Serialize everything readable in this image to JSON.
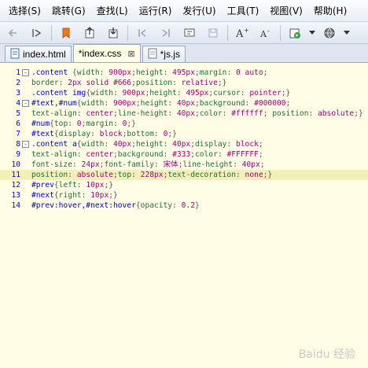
{
  "menu": [
    "选择(S)",
    "跳转(G)",
    "查找(L)",
    "运行(R)",
    "发行(U)",
    "工具(T)",
    "视图(V)",
    "帮助(H)"
  ],
  "toolbar_icons": [
    "back-icon",
    "forward-icon",
    "bookmark-icon",
    "export-icon",
    "import-icon",
    "step-back-icon",
    "step-forward-icon",
    "format-icon",
    "save-icon",
    "font-increase-icon",
    "font-decrease-icon",
    "run-icon",
    "dropdown-icon",
    "globe-icon",
    "dropdown-icon-2"
  ],
  "tabs": [
    {
      "label": "index.html",
      "icon": "html-file-icon",
      "active": false
    },
    {
      "label": "*index.css",
      "icon": "css-file-icon",
      "active": true
    },
    {
      "label": "*js.js",
      "icon": "js-file-icon",
      "active": false
    }
  ],
  "lines": [
    {
      "n": "1",
      "fold": "-",
      "segs": [
        [
          ".content ",
          "sel"
        ],
        [
          "{",
          "pun"
        ],
        [
          "width",
          "prop"
        ],
        [
          ": ",
          "pun"
        ],
        [
          "900px",
          "val"
        ],
        [
          ";",
          "pun"
        ],
        [
          "height",
          "prop"
        ],
        [
          ": ",
          "pun"
        ],
        [
          "495px",
          "val"
        ],
        [
          ";",
          "pun"
        ],
        [
          "margin",
          "prop"
        ],
        [
          ": ",
          "pun"
        ],
        [
          "0 auto",
          "val"
        ],
        [
          ";",
          "pun"
        ]
      ]
    },
    {
      "n": "2",
      "fold": "",
      "segs": [
        [
          "border",
          "prop"
        ],
        [
          ": ",
          "pun"
        ],
        [
          "2px solid #666",
          "val"
        ],
        [
          ";",
          "pun"
        ],
        [
          "position",
          "prop"
        ],
        [
          ": ",
          "pun"
        ],
        [
          "relative",
          "val"
        ],
        [
          ";}",
          "pun"
        ]
      ]
    },
    {
      "n": "3",
      "fold": "",
      "segs": [
        [
          ".content img",
          "sel"
        ],
        [
          "{",
          "pun"
        ],
        [
          "width",
          "prop"
        ],
        [
          ": ",
          "pun"
        ],
        [
          "900px",
          "val"
        ],
        [
          ";",
          "pun"
        ],
        [
          "height",
          "prop"
        ],
        [
          ": ",
          "pun"
        ],
        [
          "495px",
          "val"
        ],
        [
          ";",
          "pun"
        ],
        [
          "cursor",
          "prop"
        ],
        [
          ": ",
          "pun"
        ],
        [
          "pointer",
          "val"
        ],
        [
          ";}",
          "pun"
        ]
      ]
    },
    {
      "n": "4",
      "fold": "-",
      "segs": [
        [
          "#text,#num",
          "sel"
        ],
        [
          "{",
          "pun"
        ],
        [
          "width",
          "prop"
        ],
        [
          ": ",
          "pun"
        ],
        [
          "900px",
          "val"
        ],
        [
          ";",
          "pun"
        ],
        [
          "height",
          "prop"
        ],
        [
          ": ",
          "pun"
        ],
        [
          "40px",
          "val"
        ],
        [
          ";",
          "pun"
        ],
        [
          "background",
          "prop"
        ],
        [
          ": ",
          "pun"
        ],
        [
          "#000000",
          "val"
        ],
        [
          ";",
          "pun"
        ]
      ]
    },
    {
      "n": "5",
      "fold": "",
      "segs": [
        [
          "text-align",
          "prop"
        ],
        [
          ": ",
          "pun"
        ],
        [
          "center",
          "val"
        ],
        [
          ";",
          "pun"
        ],
        [
          "line-height",
          "prop"
        ],
        [
          ": ",
          "pun"
        ],
        [
          "40px",
          "val"
        ],
        [
          ";",
          "pun"
        ],
        [
          "color",
          "prop"
        ],
        [
          ": ",
          "pun"
        ],
        [
          "#ffffff",
          "val"
        ],
        [
          "; ",
          "pun"
        ],
        [
          "position",
          "prop"
        ],
        [
          ": ",
          "pun"
        ],
        [
          "absolute",
          "val"
        ],
        [
          ";}",
          "pun"
        ]
      ]
    },
    {
      "n": "6",
      "fold": "",
      "segs": [
        [
          "#num",
          "sel"
        ],
        [
          "{",
          "pun"
        ],
        [
          "top",
          "prop"
        ],
        [
          ": ",
          "pun"
        ],
        [
          "0",
          "val"
        ],
        [
          ";",
          "pun"
        ],
        [
          "margin",
          "prop"
        ],
        [
          ": ",
          "pun"
        ],
        [
          "0",
          "val"
        ],
        [
          ";}",
          "pun"
        ]
      ]
    },
    {
      "n": "7",
      "fold": "",
      "segs": [
        [
          "#text",
          "sel"
        ],
        [
          "{",
          "pun"
        ],
        [
          "display",
          "prop"
        ],
        [
          ": ",
          "pun"
        ],
        [
          "block",
          "val"
        ],
        [
          ";",
          "pun"
        ],
        [
          "bottom",
          "prop"
        ],
        [
          ": ",
          "pun"
        ],
        [
          "0",
          "val"
        ],
        [
          ";}",
          "pun"
        ]
      ]
    },
    {
      "n": "8",
      "fold": "-",
      "segs": [
        [
          ".content a",
          "sel"
        ],
        [
          "{",
          "pun"
        ],
        [
          "width",
          "prop"
        ],
        [
          ": ",
          "pun"
        ],
        [
          "40px",
          "val"
        ],
        [
          ";",
          "pun"
        ],
        [
          "height",
          "prop"
        ],
        [
          ": ",
          "pun"
        ],
        [
          "40px",
          "val"
        ],
        [
          ";",
          "pun"
        ],
        [
          "display",
          "prop"
        ],
        [
          ": ",
          "pun"
        ],
        [
          "block",
          "val"
        ],
        [
          ";",
          "pun"
        ]
      ]
    },
    {
      "n": "9",
      "fold": "",
      "segs": [
        [
          "text-align",
          "prop"
        ],
        [
          ": ",
          "pun"
        ],
        [
          "center",
          "val"
        ],
        [
          ";",
          "pun"
        ],
        [
          "background",
          "prop"
        ],
        [
          ": ",
          "pun"
        ],
        [
          "#333",
          "val"
        ],
        [
          ";",
          "pun"
        ],
        [
          "color",
          "prop"
        ],
        [
          ": ",
          "pun"
        ],
        [
          "#FFFFFF",
          "val"
        ],
        [
          ";",
          "pun"
        ]
      ]
    },
    {
      "n": "10",
      "fold": "",
      "segs": [
        [
          "font-size",
          "prop"
        ],
        [
          ": ",
          "pun"
        ],
        [
          "24px",
          "val"
        ],
        [
          ";",
          "pun"
        ],
        [
          "font-family",
          "prop"
        ],
        [
          ": ",
          "pun"
        ],
        [
          "宋体",
          "val"
        ],
        [
          ";",
          "pun"
        ],
        [
          "line-height",
          "prop"
        ],
        [
          ": ",
          "pun"
        ],
        [
          "40px",
          "val"
        ],
        [
          ";",
          "pun"
        ]
      ]
    },
    {
      "n": "11",
      "fold": "",
      "hl": true,
      "segs": [
        [
          "position",
          "prop"
        ],
        [
          ": ",
          "pun"
        ],
        [
          "absolute",
          "val"
        ],
        [
          ";",
          "pun"
        ],
        [
          "top",
          "prop"
        ],
        [
          ": ",
          "pun"
        ],
        [
          "228px",
          "val"
        ],
        [
          ";",
          "pun"
        ],
        [
          "text-decoration",
          "prop"
        ],
        [
          ": ",
          "pun"
        ],
        [
          "none",
          "val"
        ],
        [
          ";}",
          "pun"
        ]
      ]
    },
    {
      "n": "12",
      "fold": "",
      "segs": [
        [
          "#prev",
          "sel"
        ],
        [
          "{",
          "pun"
        ],
        [
          "left",
          "prop"
        ],
        [
          ": ",
          "pun"
        ],
        [
          "10px",
          "val"
        ],
        [
          ";}",
          "pun"
        ]
      ]
    },
    {
      "n": "13",
      "fold": "",
      "segs": [
        [
          "#next",
          "sel"
        ],
        [
          "{",
          "pun"
        ],
        [
          "right",
          "prop"
        ],
        [
          ": ",
          "pun"
        ],
        [
          "10px",
          "val"
        ],
        [
          ";}",
          "pun"
        ]
      ]
    },
    {
      "n": "14",
      "fold": "",
      "segs": [
        [
          "#prev:hover,#next:hover",
          "sel"
        ],
        [
          "{",
          "pun"
        ],
        [
          "opacity",
          "prop"
        ],
        [
          ": ",
          "pun"
        ],
        [
          "0.2",
          "val"
        ],
        [
          "}",
          "pun"
        ]
      ]
    }
  ],
  "watermark": "Baidu 经验"
}
